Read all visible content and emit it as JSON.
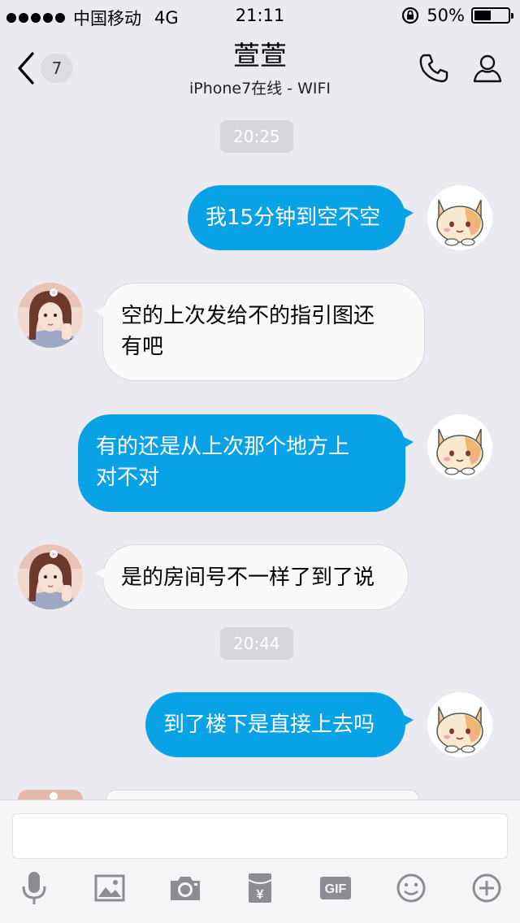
{
  "status_bar": {
    "carrier": "中国移动",
    "network": "4G",
    "time": "21:11",
    "battery_percent": "50%",
    "battery_level": 0.5
  },
  "nav": {
    "back_badge": "7",
    "title": "萱萱",
    "subtitle": "iPhone7在线 - WIFI"
  },
  "chat": {
    "timestamps": [
      "20:25",
      "20:44"
    ],
    "messages": [
      {
        "side": "out",
        "line1": "我15分钟到空不空",
        "line2": ""
      },
      {
        "side": "in",
        "line1": "空的上次发给不的指引图还",
        "line2": "有吧"
      },
      {
        "side": "out",
        "line1": "有的还是从上次那个地方上",
        "line2": "对不对"
      },
      {
        "side": "in",
        "line1": "是的房间号不一样了到了说",
        "line2": ""
      },
      {
        "side": "out",
        "line1": "到了楼下是直接上去吗",
        "line2": ""
      }
    ]
  },
  "input": {
    "placeholder": "",
    "toolbar": [
      "microphone-icon",
      "image-icon",
      "camera-icon",
      "red-packet-icon",
      "gif-icon",
      "emoji-icon",
      "plus-icon"
    ],
    "gif_label": "GIF",
    "red_packet_label": "¥"
  },
  "colors": {
    "accent": "#0aa2e6",
    "background": "#eaeaf0",
    "icon_gray": "#8c8c92"
  }
}
